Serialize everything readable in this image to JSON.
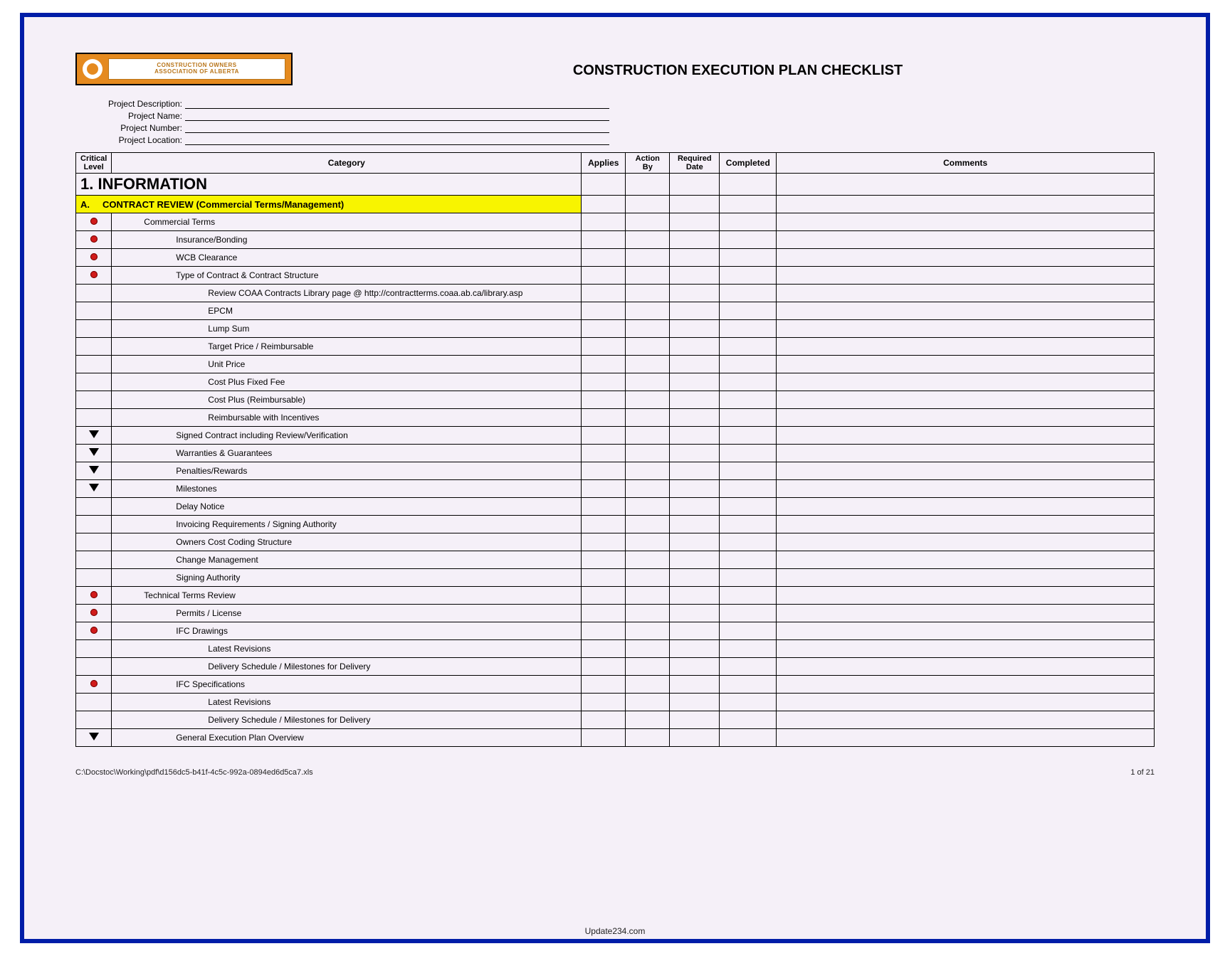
{
  "logo": {
    "line1": "CONSTRUCTION OWNERS",
    "line2": "ASSOCIATION OF ALBERTA"
  },
  "title": "CONSTRUCTION EXECUTION PLAN CHECKLIST",
  "project_fields": {
    "description": "Project Description:",
    "name": "Project Name:",
    "number": "Project Number:",
    "location": "Project Location:"
  },
  "headers": {
    "critical": "Critical Level",
    "category": "Category",
    "applies": "Applies",
    "action_by": "Action By",
    "required": "Required Date",
    "completed": "Completed",
    "comments": "Comments"
  },
  "section": {
    "number": "1.",
    "title": "INFORMATION"
  },
  "subsection": {
    "letter": "A.",
    "title": "CONTRACT REVIEW (Commercial Terms/Management)"
  },
  "rows": [
    {
      "mark": "dot",
      "indent": 1,
      "text": "Commercial Terms"
    },
    {
      "mark": "dot",
      "indent": 2,
      "text": "Insurance/Bonding"
    },
    {
      "mark": "dot",
      "indent": 2,
      "text": "WCB Clearance"
    },
    {
      "mark": "dot",
      "indent": 2,
      "text": "Type of Contract & Contract Structure"
    },
    {
      "mark": "",
      "indent": 3,
      "text": "Review COAA Contracts Library page @ http://contractterms.coaa.ab.ca/library.asp"
    },
    {
      "mark": "",
      "indent": 3,
      "text": "EPCM"
    },
    {
      "mark": "",
      "indent": 3,
      "text": "Lump Sum"
    },
    {
      "mark": "",
      "indent": 3,
      "text": "Target Price / Reimbursable"
    },
    {
      "mark": "",
      "indent": 3,
      "text": "Unit Price"
    },
    {
      "mark": "",
      "indent": 3,
      "text": "Cost Plus Fixed Fee"
    },
    {
      "mark": "",
      "indent": 3,
      "text": "Cost Plus (Reimbursable)"
    },
    {
      "mark": "",
      "indent": 3,
      "text": "Reimbursable with Incentives"
    },
    {
      "mark": "tri",
      "indent": 2,
      "text": "Signed Contract including Review/Verification"
    },
    {
      "mark": "tri",
      "indent": 2,
      "text": "Warranties & Guarantees"
    },
    {
      "mark": "tri",
      "indent": 2,
      "text": "Penalties/Rewards"
    },
    {
      "mark": "tri",
      "indent": 2,
      "text": "Milestones"
    },
    {
      "mark": "",
      "indent": 2,
      "text": "Delay Notice"
    },
    {
      "mark": "",
      "indent": 2,
      "text": "Invoicing Requirements / Signing Authority"
    },
    {
      "mark": "",
      "indent": 2,
      "text": "Owners Cost Coding Structure"
    },
    {
      "mark": "",
      "indent": 2,
      "text": "Change Management"
    },
    {
      "mark": "",
      "indent": 2,
      "text": "Signing Authority"
    },
    {
      "mark": "dot",
      "indent": 1,
      "text": "Technical Terms Review"
    },
    {
      "mark": "dot",
      "indent": 2,
      "text": "Permits / License"
    },
    {
      "mark": "dot",
      "indent": 2,
      "text": "IFC Drawings"
    },
    {
      "mark": "",
      "indent": 3,
      "text": "Latest Revisions"
    },
    {
      "mark": "",
      "indent": 3,
      "text": "Delivery Schedule / Milestones for Delivery"
    },
    {
      "mark": "dot",
      "indent": 2,
      "text": "IFC Specifications"
    },
    {
      "mark": "",
      "indent": 3,
      "text": "Latest Revisions"
    },
    {
      "mark": "",
      "indent": 3,
      "text": "Delivery Schedule / Milestones for Delivery"
    },
    {
      "mark": "tri",
      "indent": 2,
      "text": "General Execution Plan Overview"
    }
  ],
  "footer": {
    "path": "C:\\Docstoc\\Working\\pdf\\d156dc5-b41f-4c5c-992a-0894ed6d5ca7.xls",
    "page": "1 of 21",
    "credit": "Update234.com"
  }
}
